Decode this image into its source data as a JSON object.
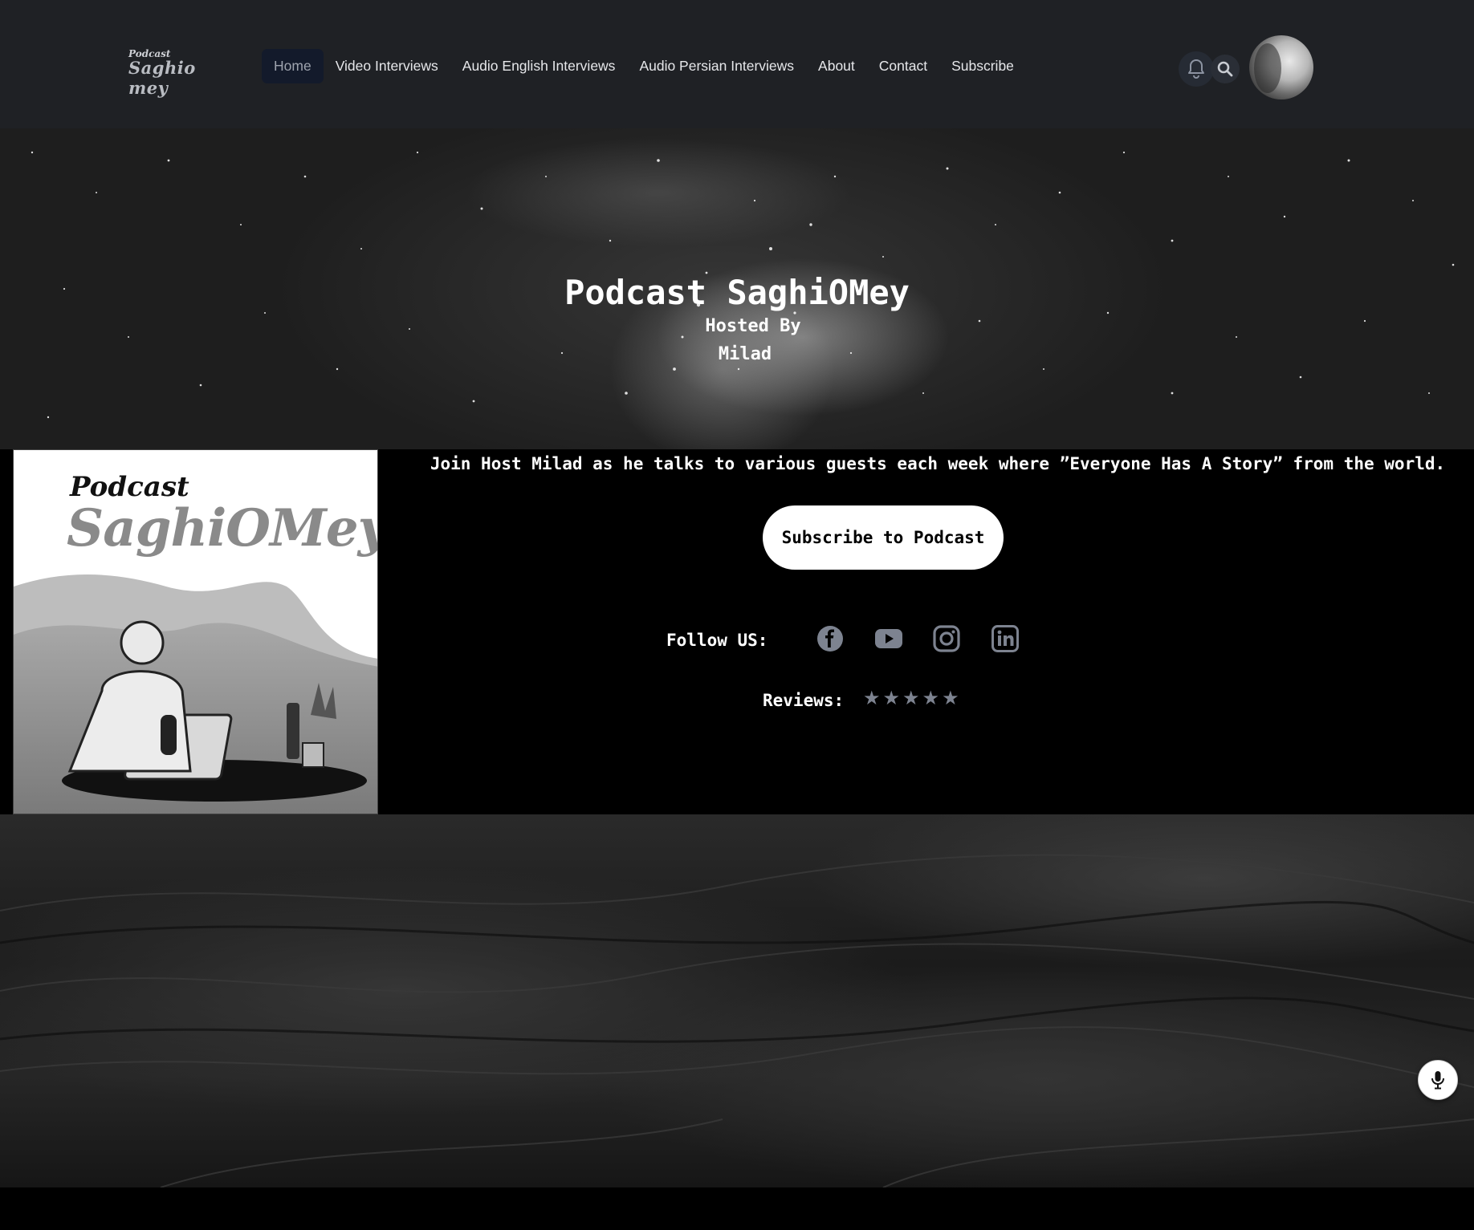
{
  "nav": {
    "logo_small": "Podcast",
    "logo_big": "Saghio mey",
    "items": [
      {
        "label": "Home",
        "active": true
      },
      {
        "label": "Video Interviews"
      },
      {
        "label": "Audio English Interviews"
      },
      {
        "label": "Audio Persian Interviews"
      },
      {
        "label": "About"
      },
      {
        "label": "Contact"
      },
      {
        "label": "Subscribe"
      }
    ],
    "icons": [
      "bell-icon",
      "search-icon",
      "avatar"
    ]
  },
  "hero": {
    "title": "Podcast SaghiOMey",
    "subtitle_1": "Hosted By",
    "subtitle_2": "Milad"
  },
  "cover": {
    "podcast_label": "Podcast",
    "name": "SaghiOMey"
  },
  "info": {
    "tagline": "Join Host Milad as he talks to various guests each week where ”Everyone Has A Story” from the world.",
    "subscribe_button": "Subscribe to Podcast",
    "follow_label": "Follow US:",
    "social": [
      "facebook-icon",
      "youtube-icon",
      "instagram-icon",
      "linkedin-icon"
    ],
    "reviews_label": "Reviews:",
    "rating": 5,
    "rating_max": 5
  },
  "floating": {
    "mic": "microphone-icon"
  },
  "colors": {
    "nav_bg": "#1f2125",
    "active_item_bg": "#131a2b",
    "icon_gray": "#7d8390"
  }
}
